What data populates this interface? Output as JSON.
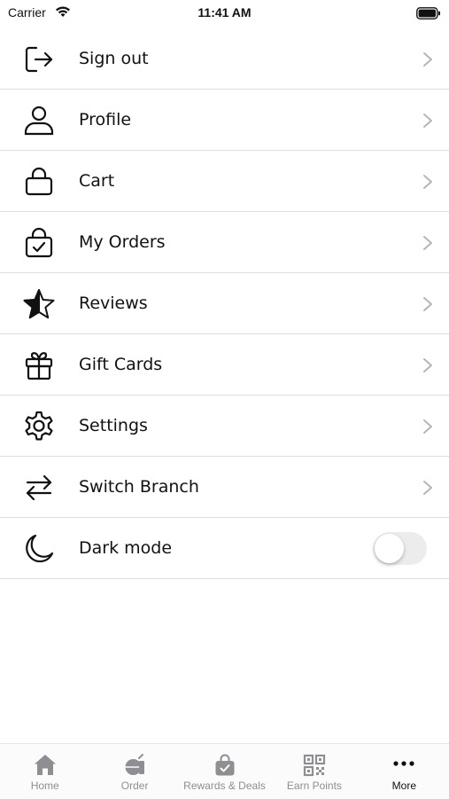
{
  "status_bar": {
    "carrier": "Carrier",
    "time": "11:41 AM"
  },
  "menu": {
    "items": [
      {
        "label": "Sign out",
        "icon": "sign-out-icon"
      },
      {
        "label": "Profile",
        "icon": "user-icon"
      },
      {
        "label": "Cart",
        "icon": "bag-icon"
      },
      {
        "label": "My Orders",
        "icon": "bag-check-icon"
      },
      {
        "label": "Reviews",
        "icon": "star-icon"
      },
      {
        "label": "Gift Cards",
        "icon": "gift-icon"
      },
      {
        "label": "Settings",
        "icon": "gear-icon"
      },
      {
        "label": "Switch Branch",
        "icon": "swap-arrows-icon"
      },
      {
        "label": "Dark mode",
        "icon": "moon-icon",
        "toggle": false
      }
    ]
  },
  "tab_bar": {
    "tabs": [
      {
        "label": "Home",
        "icon": "home-icon",
        "active": false
      },
      {
        "label": "Order",
        "icon": "order-icon",
        "active": false
      },
      {
        "label": "Rewards & Deals",
        "icon": "rewards-bag-icon",
        "active": false
      },
      {
        "label": "Earn Points",
        "icon": "qr-code-icon",
        "active": false
      },
      {
        "label": "More",
        "icon": "more-dots-icon",
        "active": true
      }
    ]
  },
  "colors": {
    "divider": "#dedede",
    "tab_inactive": "#8e8e93",
    "tab_active": "#111111"
  }
}
